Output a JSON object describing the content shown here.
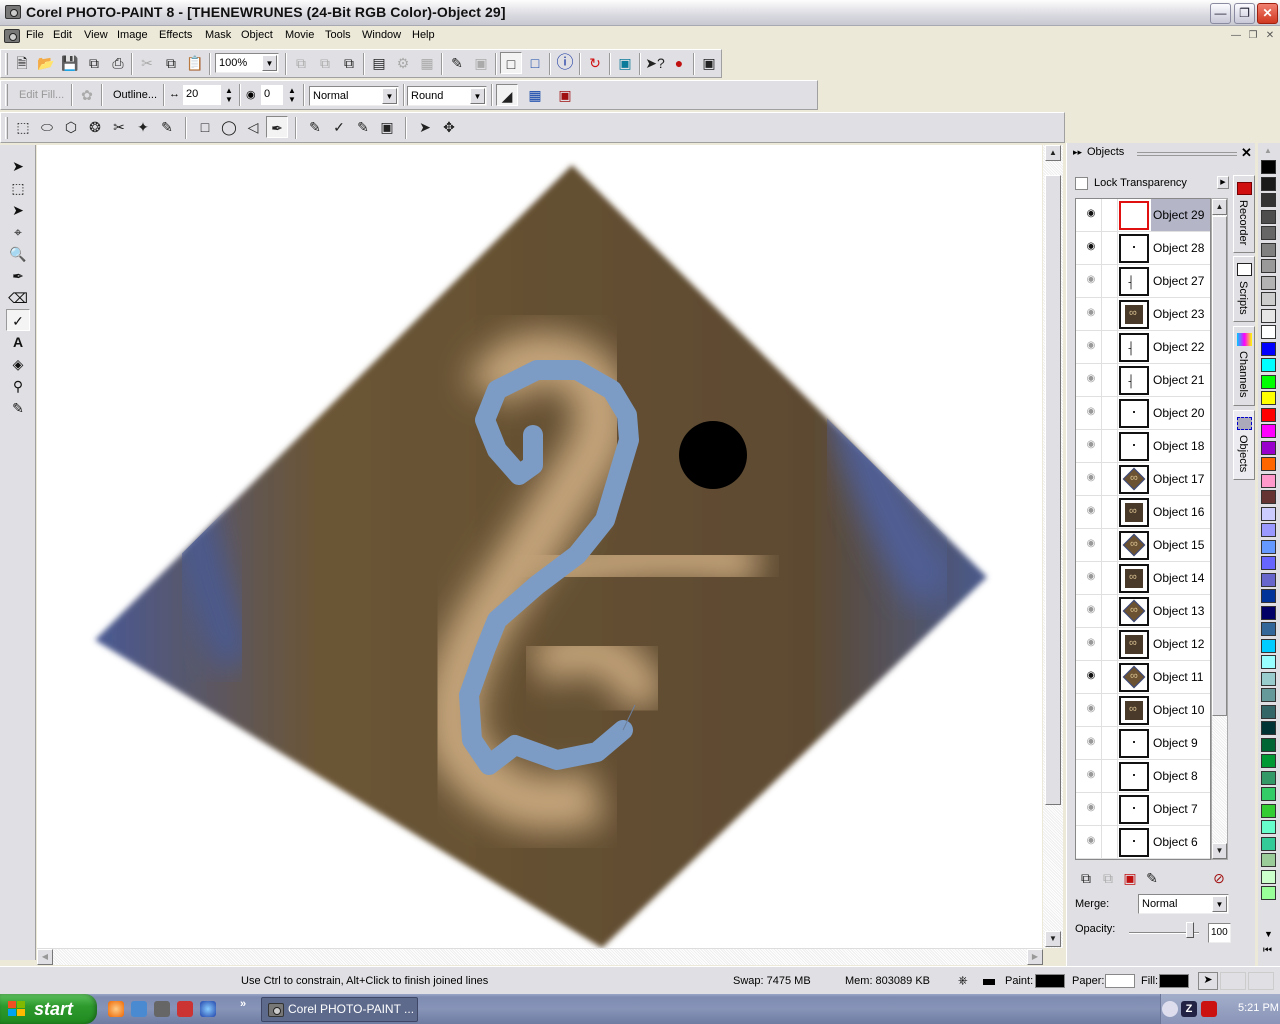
{
  "window": {
    "title": "Corel PHOTO-PAINT 8 - [THENEWRUNES  (24-Bit RGB Color)-Object 29]",
    "minimize_icon": "minimize-icon",
    "restore_icon": "restore-icon",
    "close_icon": "close-icon"
  },
  "menu": {
    "items": [
      "File",
      "Edit",
      "View",
      "Image",
      "Effects",
      "Mask",
      "Object",
      "Movie",
      "Tools",
      "Window",
      "Help"
    ]
  },
  "standard_toolbar": {
    "zoom_value": "100%",
    "icons": [
      "new-icon",
      "open-icon",
      "save-icon",
      "export-icon",
      "print-icon",
      "cut-icon",
      "copy-icon",
      "paste-icon",
      "combine-icon",
      "group-icon",
      "crop-to-object-icon",
      "marquee-icon",
      "mask-overlay-icon",
      "marquee-visible-icon",
      "mask-icon",
      "invert-icon",
      "object-marquee-icon",
      "show-objects-icon",
      "info-icon",
      "rotate-icon",
      "properties-icon",
      "help-pointer-icon",
      "apple-icon",
      "fullscreen-icon"
    ]
  },
  "property_bar": {
    "edit_fill_label": "Edit Fill...",
    "outline_label": "Outline...",
    "width_value": "20",
    "transparency_value": "0",
    "merge_mode": "Normal",
    "join_style": "Round"
  },
  "toolbox": {
    "tools": [
      "pick-tool",
      "rectangle-mask-tool",
      "mask-transform-tool",
      "crop-tool",
      "zoom-tool",
      "eyedropper-tool",
      "eraser-tool",
      "effect-tool",
      "text-tool",
      "fill-tool",
      "object-picker-tool",
      "paint-tool"
    ],
    "active": "effect-tool"
  },
  "objects_docker": {
    "title": "Objects",
    "lock_transparency_label": "Lock Transparency",
    "lock_transparency_checked": false,
    "objects": [
      {
        "name": "Object 29",
        "visible": true,
        "selected": true,
        "thumb": "empty-red"
      },
      {
        "name": "Object 28",
        "visible": true,
        "selected": false,
        "thumb": "dot"
      },
      {
        "name": "Object 27",
        "visible": false,
        "selected": false,
        "thumb": "rune-black"
      },
      {
        "name": "Object 23",
        "visible": false,
        "selected": false,
        "thumb": "rune-tile"
      },
      {
        "name": "Object 22",
        "visible": false,
        "selected": false,
        "thumb": "rune-black"
      },
      {
        "name": "Object 21",
        "visible": false,
        "selected": false,
        "thumb": "rune-black"
      },
      {
        "name": "Object 20",
        "visible": false,
        "selected": false,
        "thumb": "dot"
      },
      {
        "name": "Object 18",
        "visible": false,
        "selected": false,
        "thumb": "dot"
      },
      {
        "name": "Object 17",
        "visible": false,
        "selected": false,
        "thumb": "rune-diamond"
      },
      {
        "name": "Object 16",
        "visible": false,
        "selected": false,
        "thumb": "rune-tile"
      },
      {
        "name": "Object 15",
        "visible": false,
        "selected": false,
        "thumb": "rune-diamond"
      },
      {
        "name": "Object 14",
        "visible": false,
        "selected": false,
        "thumb": "rune-tile"
      },
      {
        "name": "Object 13",
        "visible": false,
        "selected": false,
        "thumb": "rune-diamond"
      },
      {
        "name": "Object 12",
        "visible": false,
        "selected": false,
        "thumb": "rune-tile"
      },
      {
        "name": "Object 11",
        "visible": true,
        "selected": false,
        "thumb": "rune-diamond"
      },
      {
        "name": "Object 10",
        "visible": false,
        "selected": false,
        "thumb": "rune-tile"
      },
      {
        "name": "Object 9",
        "visible": false,
        "selected": false,
        "thumb": "dot"
      },
      {
        "name": "Object 8",
        "visible": false,
        "selected": false,
        "thumb": "dot"
      },
      {
        "name": "Object 7",
        "visible": false,
        "selected": false,
        "thumb": "dot"
      },
      {
        "name": "Object 6",
        "visible": false,
        "selected": false,
        "thumb": "dot"
      }
    ],
    "merge_label": "Merge:",
    "merge_value": "Normal",
    "opacity_label": "Opacity:",
    "opacity_value": "100"
  },
  "side_tabs": [
    "Recorder",
    "Scripts",
    "Channels",
    "Objects"
  ],
  "palette": {
    "colors": [
      "#000000",
      "#1a1a1a",
      "#333333",
      "#4d4d4d",
      "#666666",
      "#808080",
      "#999999",
      "#b3b3b3",
      "#cccccc",
      "#e6e6e6",
      "#ffffff",
      "#0000ff",
      "#00ffff",
      "#00ff00",
      "#ffff00",
      "#ff0000",
      "#ff00ff",
      "#9900cc",
      "#ff6600",
      "#ff99cc",
      "#663333",
      "#ccccff",
      "#9999ff",
      "#6699ff",
      "#6666ff",
      "#6666cc",
      "#003399",
      "#000066",
      "#336699",
      "#00ccff",
      "#99ffff",
      "#99cccc",
      "#669999",
      "#336666",
      "#003333",
      "#006633",
      "#009933",
      "#339966",
      "#33cc66",
      "#33cc33",
      "#66ffcc",
      "#33cc99",
      "#99cc99",
      "#ccffcc",
      "#99ff99"
    ]
  },
  "status": {
    "hint": "Use Ctrl to constrain, Alt+Click to finish joined lines",
    "swap": "Swap: 7475 MB",
    "mem": "Mem: 803089 KB",
    "paint_label": "Paint:",
    "paper_label": "Paper:",
    "fill_label": "Fill:",
    "paint_color": "#000000",
    "paper_color": "#ffffff",
    "fill_color": "#000000"
  },
  "canvas": {
    "diamond_color": "#6b5232",
    "stroke_color": "#7c9cc6",
    "dot_color": "#000000"
  },
  "taskbar": {
    "start_label": "start",
    "task_label": "Corel PHOTO-PAINT ...",
    "clock": "5:21 PM"
  }
}
